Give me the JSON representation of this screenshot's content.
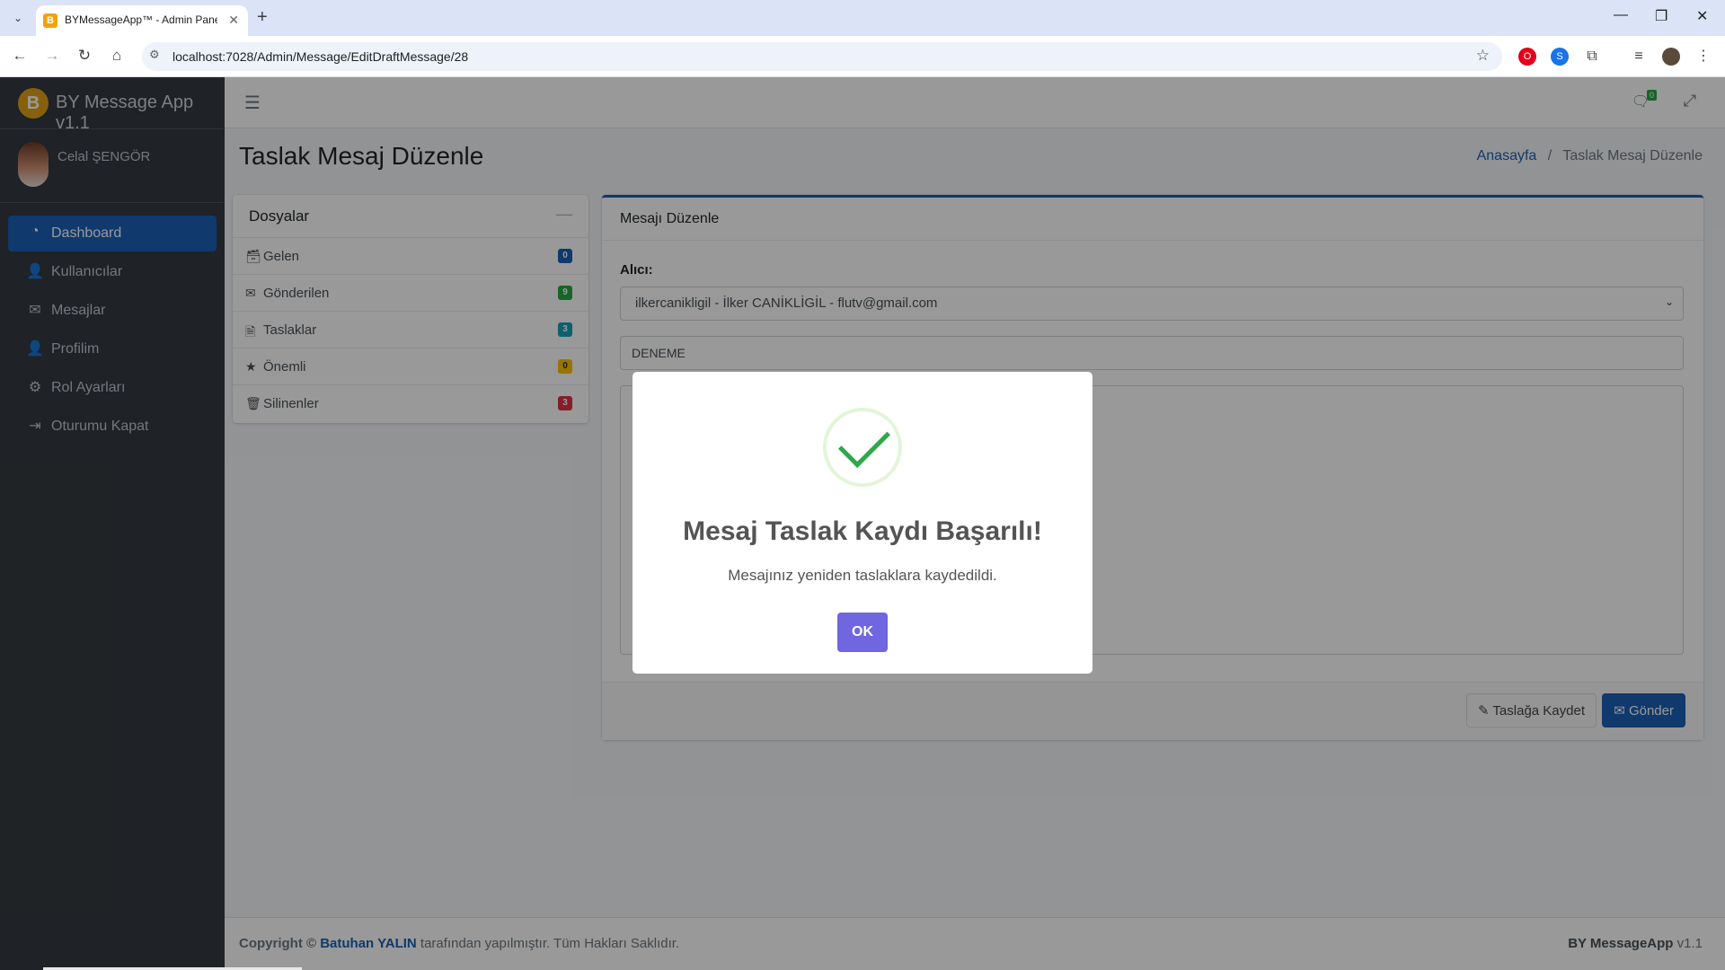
{
  "browser": {
    "tab_title": "BYMessageApp™ - Admin Panel",
    "url": "localhost:7028/Admin/Message/EditDraftMessage/28"
  },
  "brand": {
    "logo_letter": "B",
    "title": "BY Message App v1.1"
  },
  "user": {
    "name": "Celal ŞENGÖR"
  },
  "sidebar": {
    "items": [
      {
        "label": "Dashboard",
        "icon": "dashboard-icon",
        "glyph": "◔",
        "active": true
      },
      {
        "label": "Kullanıcılar",
        "icon": "user-icon",
        "glyph": "👤",
        "active": false
      },
      {
        "label": "Mesajlar",
        "icon": "envelope-icon",
        "glyph": "✉",
        "active": false
      },
      {
        "label": "Profilim",
        "icon": "user-edit-icon",
        "glyph": "👤",
        "active": false
      },
      {
        "label": "Rol Ayarları",
        "icon": "gears-icon",
        "glyph": "⚙",
        "active": false
      },
      {
        "label": "Oturumu Kapat",
        "icon": "sign-out-icon",
        "glyph": "⇥",
        "active": false
      }
    ]
  },
  "topnav": {
    "chat_count": "0"
  },
  "page": {
    "title": "Taslak Mesaj Düzenle",
    "breadcrumb_home": "Anasayfa",
    "breadcrumb_separator": "/",
    "breadcrumb_current": "Taslak Mesaj Düzenle"
  },
  "folders": {
    "title": "Dosyalar",
    "items": [
      {
        "label": "Gelen",
        "count": "0",
        "icon": "inbox-icon",
        "glyph": "🗃",
        "color": "#1c60b6"
      },
      {
        "label": "Gönderilen",
        "count": "9",
        "icon": "envelope-icon",
        "glyph": "✉",
        "color": "#28a745"
      },
      {
        "label": "Taslaklar",
        "count": "3",
        "icon": "file-icon",
        "glyph": "🗎",
        "color": "#17a2b8"
      },
      {
        "label": "Önemli",
        "count": "0",
        "icon": "star-icon",
        "glyph": "★",
        "color": "#ffc107"
      },
      {
        "label": "Silinenler",
        "count": "3",
        "icon": "trash-icon",
        "glyph": "🗑",
        "color": "#dc3545"
      }
    ]
  },
  "editor": {
    "title": "Mesajı Düzenle",
    "recipient_label": "Alıcı:",
    "recipient_value": "ilkercanikligil - İlker CANİKLİGİL - flutv@gmail.com",
    "subject_value": "DENEME",
    "save_draft_label": "Taslağa Kaydet",
    "send_label": "Gönder"
  },
  "footer": {
    "copyright_prefix": "Copyright ©",
    "author": "Batuhan YALIN",
    "copyright_suffix": "tarafından yapılmıştır. Tüm Hakları Saklıdır.",
    "app_name": "BY MessageApp",
    "version": "v1.1"
  },
  "modal": {
    "title": "Mesaj Taslak Kaydı Başarılı!",
    "text": "Mesajınız yeniden taslaklara kaydedildi.",
    "ok_label": "OK"
  }
}
